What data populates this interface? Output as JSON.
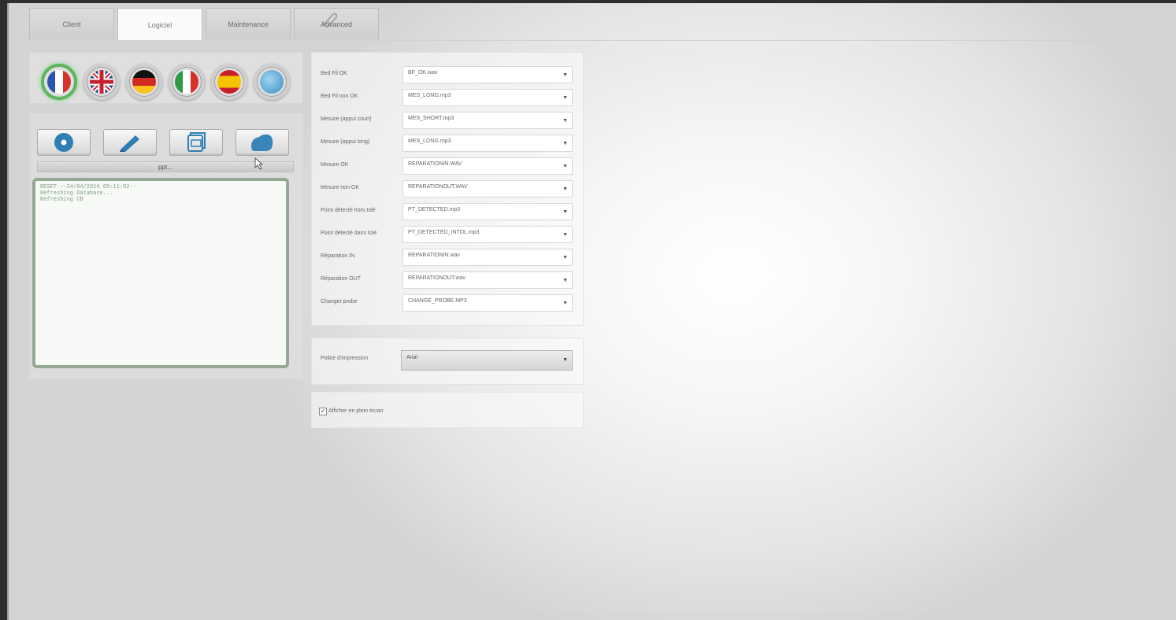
{
  "tabs": [
    {
      "label": "Client",
      "active": false
    },
    {
      "label": "Logiciel",
      "active": true
    },
    {
      "label": "Maintenance",
      "active": false
    },
    {
      "label": "Advanced",
      "active": false
    }
  ],
  "languages": [
    {
      "name": "French",
      "selected": true,
      "icon": "flag-fr"
    },
    {
      "name": "English",
      "selected": false,
      "icon": "flag-uk"
    },
    {
      "name": "German",
      "selected": false,
      "icon": "flag-de"
    },
    {
      "name": "Italian",
      "selected": false,
      "icon": "flag-it"
    },
    {
      "name": "Spanish",
      "selected": false,
      "icon": "flag-es"
    },
    {
      "name": "World",
      "selected": false,
      "icon": "globe"
    }
  ],
  "toolbar": {
    "buttons": [
      "disc-icon",
      "pencil-icon",
      "database-icon",
      "cloud-icon"
    ],
    "progress_label": "ppt..."
  },
  "log": {
    "lines": [
      "RESET --24/04/2014 09:11:02--",
      "Refreshing Database...",
      "Refreshing CB"
    ]
  },
  "sounds": [
    {
      "label": "Bed Fil OK",
      "value": "BF_OK.wav"
    },
    {
      "label": "Bed Fil non OK",
      "value": "MES_LONG.mp3"
    },
    {
      "label": "Mesure (appui court)",
      "value": "MES_SHORT.mp3"
    },
    {
      "label": "Mesure (appui long)",
      "value": "MES_LONG.mp3"
    },
    {
      "label": "Mesure OK",
      "value": "REPARATIONIN.WAV"
    },
    {
      "label": "Mesure non OK",
      "value": "REPARATIONOUT.WAV"
    },
    {
      "label": "Point détecté hors tolé",
      "value": "PT_DETECTED.mp3"
    },
    {
      "label": "Point détecté dans tolé",
      "value": "PT_DETECTED_INTOL.mp3"
    },
    {
      "label": "Réparation IN",
      "value": "REPARATIONIN.wav"
    },
    {
      "label": "Réparation OUT",
      "value": "REPARATIONOUT.wav"
    },
    {
      "label": "Changer probe",
      "value": "CHANGE_PROBE.MP3"
    }
  ],
  "print_font": {
    "label": "Police d'impression",
    "value": "Arial"
  },
  "fullscreen": {
    "label": "Afficher en plein écran",
    "checked": true,
    "mark": "✓"
  },
  "colors": {
    "selected_flag": "#5fb45f",
    "log_border": "#93a993",
    "log_text": "#7fa07f"
  }
}
